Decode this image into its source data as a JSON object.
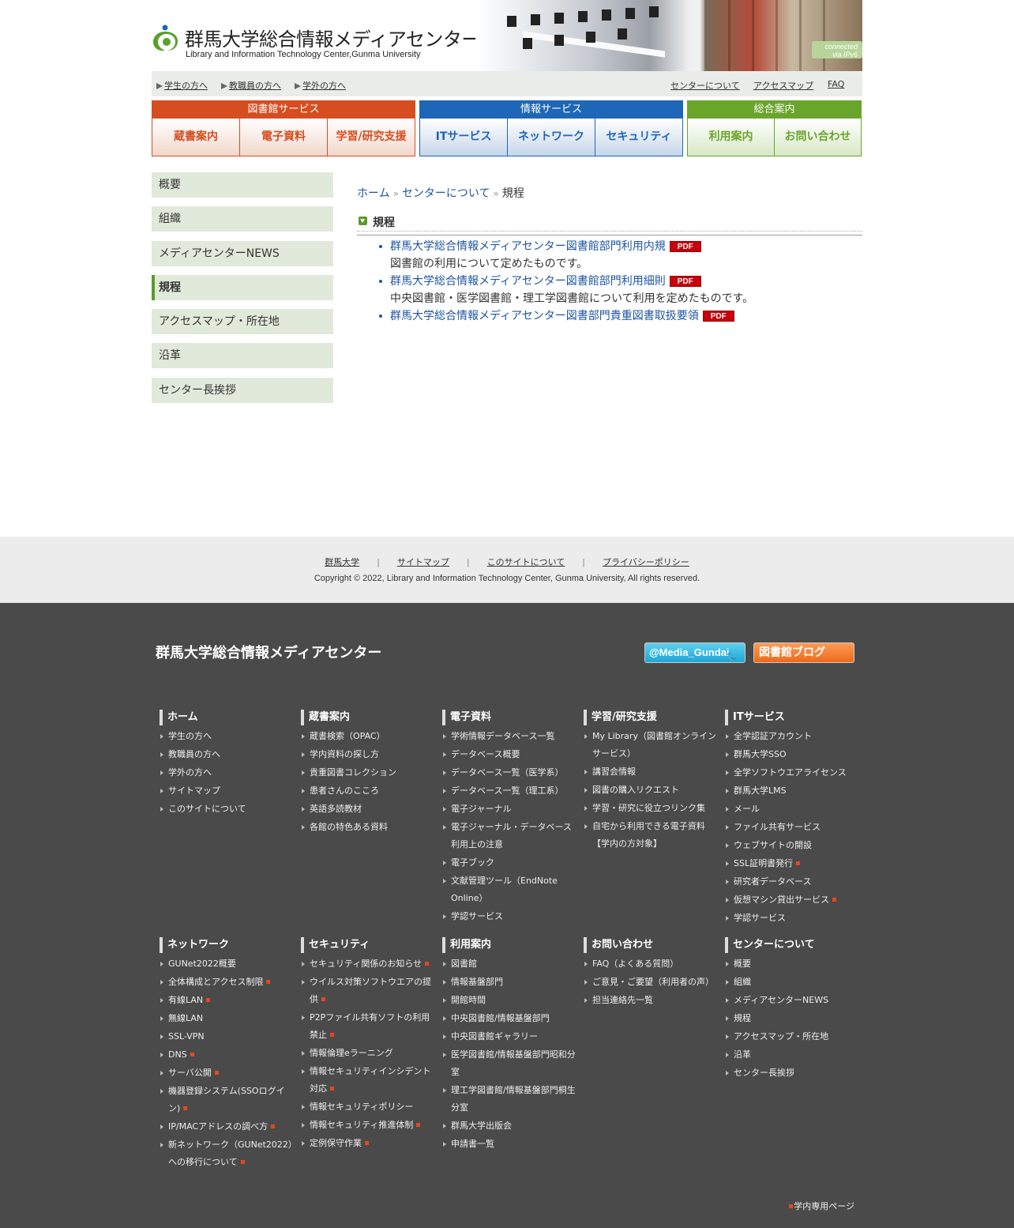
{
  "header": {
    "logo_jp": "群馬大学総合情報メディアセンター",
    "logo_en": "Library and Information Technology Center,Gunma University",
    "ipv6_badge_line1": "connected",
    "ipv6_badge_line2": "via IPv6"
  },
  "subnav": {
    "left": [
      "学生の方へ",
      "教職員の方へ",
      "学外の方へ"
    ],
    "right": [
      "センターについて",
      "アクセスマップ",
      "FAQ"
    ]
  },
  "mainnav": {
    "library": {
      "title": "図書館サービス",
      "items": [
        "蔵書案内",
        "電子資料",
        "学習/研究支援"
      ]
    },
    "info": {
      "title": "情報サービス",
      "items": [
        "ITサービス",
        "ネットワーク",
        "セキュリティ"
      ]
    },
    "general": {
      "title": "総合案内",
      "items": [
        "利用案内",
        "お問い合わせ"
      ]
    }
  },
  "sidemenu": [
    "概要",
    "組織",
    "メディアセンターNEWS",
    "規程",
    "アクセスマップ・所在地",
    "沿革",
    "センター長挨拶"
  ],
  "breadcrumb": {
    "home": "ホーム",
    "parent": "センターについて",
    "current": "規程",
    "sep": "»"
  },
  "section": {
    "title": "規程"
  },
  "regulations": [
    {
      "title": "群馬大学総合情報メディアセンター図書館部門利用内規",
      "desc": "図書館の利用について定めたものです。",
      "badge": "PDF"
    },
    {
      "title": "群馬大学総合情報メディアセンター図書館部門利用細則",
      "desc": "中央図書館・医学図書館・理工学図書館について利用を定めたものです。",
      "badge": "PDF"
    },
    {
      "title": "群馬大学総合情報メディアセンター図書部門貴重図書取扱要領",
      "desc": "",
      "badge": "PDF"
    }
  ],
  "footer_links": [
    "群馬大学",
    "サイトマップ",
    "このサイトについて",
    "プライバシーポリシー"
  ],
  "footer_sep": "|",
  "copyright": "Copyright © 2022, Library and Information Technology Center, Gunma University, All rights reserved.",
  "dark_footer": {
    "title": "群馬大学総合情報メディアセンター",
    "twitter": "@Media_Gundai",
    "blog": "図書館ブログ",
    "internal": "学内専用ページ"
  },
  "colors": {
    "library": "#d64e20",
    "info": "#1e66b8",
    "general": "#6aa52b",
    "footer_dark": "#4a4a4a"
  },
  "footer_columns": [
    {
      "title": "ホーム",
      "items": [
        [
          "学生の方へ",
          false
        ],
        [
          "教職員の方へ",
          false
        ],
        [
          "学外の方へ",
          false
        ],
        [
          "サイトマップ",
          false
        ],
        [
          "このサイトについて",
          false
        ]
      ]
    },
    {
      "title": "蔵書案内",
      "items": [
        [
          "蔵書検索（OPAC）",
          false
        ],
        [
          "学内資料の探し方",
          false
        ],
        [
          "貴重図書コレクション",
          false
        ],
        [
          "患者さんのこころ",
          false
        ],
        [
          "英語多読教材",
          false
        ],
        [
          "各館の特色ある資料",
          false
        ]
      ]
    },
    {
      "title": "電子資料",
      "items": [
        [
          "学術情報データベース一覧",
          false
        ],
        [
          "データベース概要",
          false
        ],
        [
          "データベース一覧（医学系）",
          false
        ],
        [
          "データベース一覧（理工系）",
          false
        ],
        [
          "電子ジャーナル",
          false
        ],
        [
          "電子ジャーナル・データベース利用上の注意",
          false
        ],
        [
          "電子ブック",
          false
        ],
        [
          "文献管理ツール（EndNote Online）",
          false
        ],
        [
          "学認サービス",
          false
        ]
      ]
    },
    {
      "title": "学習/研究支援",
      "items": [
        [
          "My Library（図書館オンラインサービス）",
          false
        ],
        [
          "講習会情報",
          false
        ],
        [
          "図書の購入リクエスト",
          false
        ],
        [
          "学習・研究に役立つリンク集",
          false
        ],
        [
          "自宅から利用できる電子資料【学内の方対象】",
          false
        ]
      ]
    },
    {
      "title": "ITサービス",
      "items": [
        [
          "全学認証アカウント",
          false
        ],
        [
          "群馬大学SSO",
          false
        ],
        [
          "全学ソフトウエアライセンス",
          false
        ],
        [
          "群馬大学LMS",
          false
        ],
        [
          "メール",
          false
        ],
        [
          "ファイル共有サービス",
          false
        ],
        [
          "ウェブサイトの開設",
          false
        ],
        [
          "SSL証明書発行",
          true
        ],
        [
          "研究者データベース",
          false
        ],
        [
          "仮想マシン貸出サービス",
          true
        ],
        [
          "学認サービス",
          false
        ]
      ]
    },
    {
      "title": "ネットワーク",
      "items": [
        [
          "GUNet2022概要",
          false
        ],
        [
          "全体構成とアクセス制限",
          true
        ],
        [
          "有線LAN",
          true
        ],
        [
          "無線LAN",
          false
        ],
        [
          "SSL-VPN",
          false
        ],
        [
          "DNS",
          true
        ],
        [
          "サーバ公開",
          true
        ],
        [
          "機器登録システム(SSOログイン)",
          true
        ],
        [
          "IP/MACアドレスの調べ方",
          true
        ],
        [
          "新ネットワーク（GUNet2022）への移行について",
          true
        ]
      ]
    },
    {
      "title": "セキュリティ",
      "items": [
        [
          "セキュリティ関係のお知らせ",
          true
        ],
        [
          "ウイルス対策ソフトウエアの提供",
          true
        ],
        [
          "P2Pファイル共有ソフトの利用禁止",
          true
        ],
        [
          "情報倫理eラーニング",
          false
        ],
        [
          "情報セキュリティインシデント対応",
          true
        ],
        [
          "情報セキュリティポリシー",
          false
        ],
        [
          "情報セキュリティ推進体制",
          true
        ],
        [
          "定例保守作業",
          true
        ]
      ]
    },
    {
      "title": "利用案内",
      "items": [
        [
          "図書館",
          false
        ],
        [
          "情報基盤部門",
          false
        ],
        [
          "開館時間",
          false
        ],
        [
          "中央図書館/情報基盤部門",
          false
        ],
        [
          "中央図書館ギャラリー",
          false
        ],
        [
          "医学図書館/情報基盤部門昭和分室",
          false
        ],
        [
          "理工学図書館/情報基盤部門桐生分室",
          false
        ],
        [
          "群馬大学出版会",
          false
        ],
        [
          "申請書一覧",
          false
        ]
      ]
    },
    {
      "title": "お問い合わせ",
      "items": [
        [
          "FAQ（よくある質問）",
          false
        ],
        [
          "ご意見・ご要望（利用者の声）",
          false
        ],
        [
          "担当連絡先一覧",
          false
        ]
      ]
    },
    {
      "title": "センターについて",
      "items": [
        [
          "概要",
          false
        ],
        [
          "組織",
          false
        ],
        [
          "メディアセンターNEWS",
          false
        ],
        [
          "規程",
          false
        ],
        [
          "アクセスマップ・所在地",
          false
        ],
        [
          "沿革",
          false
        ],
        [
          "センター長挨拶",
          false
        ]
      ]
    }
  ]
}
